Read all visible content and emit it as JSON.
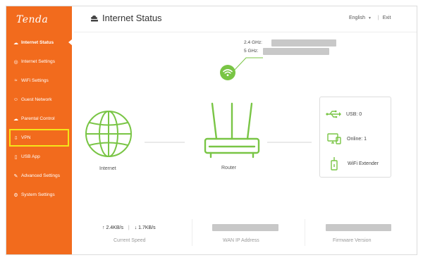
{
  "brand": {
    "logo": "Tenda",
    "accent": "#f26b1d",
    "highlight": "#f5e51a",
    "green": "#79c545"
  },
  "sidebar": {
    "items": [
      {
        "label": "Internet Status",
        "icon": "internet-status-icon",
        "glyph": "☁",
        "active": true
      },
      {
        "label": "Internet Settings",
        "icon": "globe-icon",
        "glyph": "◎"
      },
      {
        "label": "WiFi Settings",
        "icon": "wifi-icon",
        "glyph": "≈"
      },
      {
        "label": "Guest Network",
        "icon": "guest-icon",
        "glyph": "☺"
      },
      {
        "label": "Parental Control",
        "icon": "parental-icon",
        "glyph": "☁"
      },
      {
        "label": "VPN",
        "icon": "vpn-download-icon",
        "glyph": "⇩",
        "highlighted": true
      },
      {
        "label": "USB App",
        "icon": "usb-icon",
        "glyph": "▯"
      },
      {
        "label": "Advanced Settings",
        "icon": "wrench-icon",
        "glyph": "✎"
      },
      {
        "label": "System Settings",
        "icon": "settings-gear-icon",
        "glyph": "⚙"
      }
    ]
  },
  "header": {
    "title": "Internet Status",
    "language": "English",
    "exit": "Exit"
  },
  "wifi": {
    "band_24": "2.4 GHz:",
    "band_5": "5 GHz:"
  },
  "diagram": {
    "internet_label": "Internet",
    "router_label": "Router",
    "usb": "USB:  0",
    "online": "Online:  1",
    "extender": "WiFi Extender"
  },
  "stats": {
    "upload": "↑ 2.4KB/s",
    "separator": "|",
    "download": "↓ 1.7KB/s",
    "speed_label": "Current Speed",
    "wan_label": "WAN IP Address",
    "firmware_label": "Firmware Version"
  }
}
